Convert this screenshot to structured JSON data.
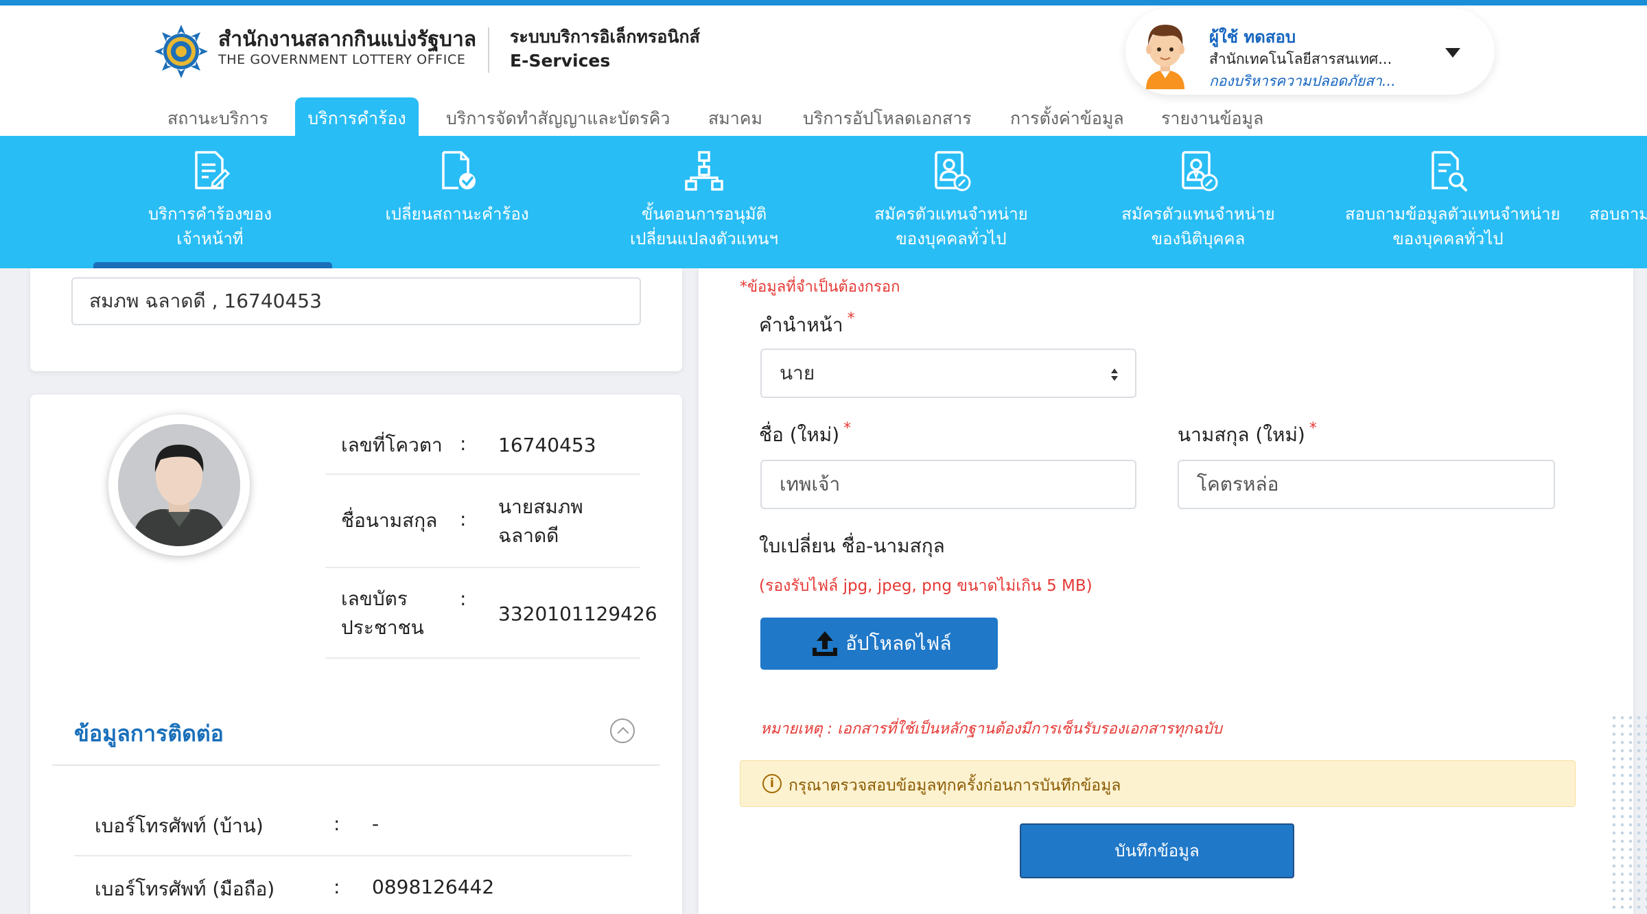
{
  "header": {
    "org_name_th": "สำนักงานสลากกินแบ่งรัฐบาล",
    "org_name_en": "THE GOVERNMENT LOTTERY OFFICE",
    "system_name_th": "ระบบบริการอิเล็กทรอนิกส์",
    "system_name_en": "E-Services"
  },
  "user": {
    "name": "ผู้ใช้ ทดสอบ",
    "department": "สำนักเทคโนโลยีสารสนเทศ...",
    "division": "กองบริหารความปลอดภัยสา...",
    "avatar_icon": "user-avatar-icon",
    "menu_icon": "caret-down-icon"
  },
  "main_tabs": [
    {
      "label": "สถานะบริการ",
      "active": false
    },
    {
      "label": "บริการคำร้อง",
      "active": true
    },
    {
      "label": "บริการจัดทำสัญญาและบัตรคิว",
      "active": false
    },
    {
      "label": "สมาคม",
      "active": false
    },
    {
      "label": "บริการอัปโหลดเอกสาร",
      "active": false
    },
    {
      "label": "การตั้งค่าข้อมูล",
      "active": false
    },
    {
      "label": "รายงานข้อมูล",
      "active": false
    }
  ],
  "sub_menu": [
    {
      "line1": "บริการคำร้องของ",
      "line2": "เจ้าหน้าที่",
      "icon": "document-edit-icon",
      "active": true
    },
    {
      "line1": "เปลี่ยนสถานะคำร้อง",
      "line2": "",
      "icon": "document-check-icon",
      "active": false
    },
    {
      "line1": "ขั้นตอนการอนุมัติ",
      "line2": "เปลี่ยนแปลงตัวแทนฯ",
      "icon": "workflow-icon",
      "active": false
    },
    {
      "line1": "สมัครตัวแทนจำหน่าย",
      "line2": "ของบุคคลทั่วไป",
      "icon": "person-register-icon",
      "active": false
    },
    {
      "line1": "สมัครตัวแทนจำหน่าย",
      "line2": "ของนิติบุคคล",
      "icon": "company-register-icon",
      "active": false
    },
    {
      "line1": "สอบถามข้อมูลตัวแทนจำหน่าย",
      "line2": "ของบุคคลทั่วไป",
      "icon": "document-search-icon",
      "active": false
    },
    {
      "line1": "สอบถาม",
      "line2": "",
      "icon": "",
      "active": false
    }
  ],
  "agent_search": {
    "value": "สมภพ  ฉลาดดี , 16740453"
  },
  "agent_profile": {
    "photo_icon": "person-photo-icon",
    "fields": [
      {
        "label": "เลขที่โควตา",
        "value": "16740453"
      },
      {
        "label": "ชื่อนามสกุล",
        "value_line1": "นายสมภพ",
        "value_line2": "ฉลาดดี"
      },
      {
        "label_line1": "เลขบัตร",
        "label_line2": "ประชาชน",
        "value": "3320101129426"
      }
    ],
    "colon": ":"
  },
  "contact": {
    "title": "ข้อมูลการติดต่อ",
    "collapse_icon": "chevron-up-icon",
    "rows": [
      {
        "label": "เบอร์โทรศัพท์ (บ้าน)",
        "value": "-"
      },
      {
        "label": "เบอร์โทรศัพท์ (มือถือ)",
        "value": "0898126442"
      }
    ]
  },
  "form": {
    "required_note": "*ข้อมูลที่จำเป็นต้องกรอก",
    "title_label": "คำนำหน้า",
    "title_value": "นาย",
    "first_name_label": "ชื่อ (ใหม่)",
    "first_name_value": "เทพเจ้า",
    "last_name_label": "นามสกุล (ใหม่)",
    "last_name_value": "โคตรหล่อ",
    "required_mark": "*",
    "upload_label": "ใบเปลี่ยน ชื่อ-นามสกุล",
    "file_hint": "(รองรับไฟล์ jpg, jpeg, png ขนาดไม่เกิน 5 MB)",
    "upload_button": "อัปโหลดไฟล์",
    "upload_icon": "upload-icon",
    "remark": "หมายเหตุ : เอกสารที่ใช้เป็นหลักฐานต้องมีการเซ็นรับรองเอกสารทุกฉบับ",
    "alert_icon": "info-icon",
    "alert_icon_glyph": "i",
    "alert": "กรุณาตรวจสอบข้อมูลทุกครั้งก่อนการบันทึกข้อมูล",
    "save_button": "บันทึกข้อมูล"
  },
  "colors": {
    "accent": "#29bdf5",
    "primary_button": "#1f78c8",
    "header_link": "#1565c0",
    "required": "#e53935",
    "alert_bg": "#fdf2d0"
  }
}
